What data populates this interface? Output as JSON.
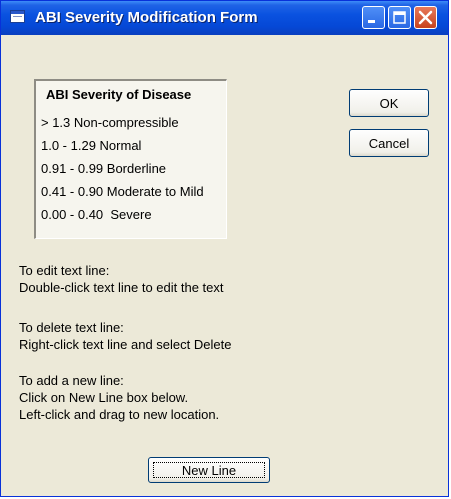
{
  "window": {
    "title": "ABI Severity Modification Form"
  },
  "list": {
    "title": "ABI Severity of Disease",
    "items": [
      "> 1.3 Non-compressible",
      "1.0 - 1.29 Normal",
      "0.91 - 0.99 Borderline",
      "0.41 - 0.90 Moderate to Mild",
      "0.00 - 0.40  Severe"
    ]
  },
  "buttons": {
    "ok": "OK",
    "cancel": "Cancel",
    "new_line": "New Line"
  },
  "instructions": [
    {
      "heading": "To edit text line:",
      "text": "Double-click text line to edit the text"
    },
    {
      "heading": "To delete text line:",
      "text": "Right-click text line and select Delete"
    },
    {
      "heading": "To add a new line:",
      "text": "Click on New Line box below.",
      "text2": "Left-click and drag to new location."
    }
  ],
  "colors": {
    "titlebar": "#0a52e0",
    "dialog_bg": "#ece9d8",
    "close_button": "#c7421e"
  }
}
